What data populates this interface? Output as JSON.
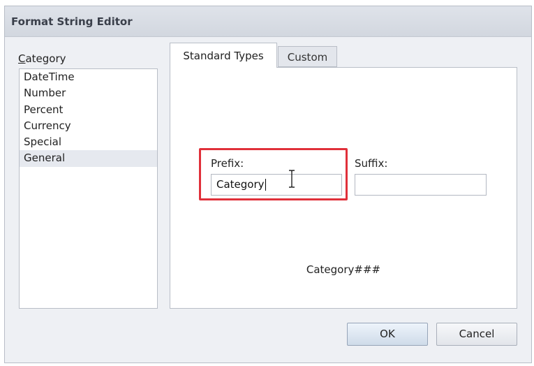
{
  "dialog": {
    "title": "Format String Editor"
  },
  "category": {
    "label_accel": "C",
    "label_rest": "ategory",
    "items": [
      "DateTime",
      "Number",
      "Percent",
      "Currency",
      "Special",
      "General"
    ],
    "selected": "General"
  },
  "tabs": [
    {
      "label": "Standard Types",
      "active": true
    },
    {
      "label": "Custom",
      "active": false
    }
  ],
  "prefix": {
    "label": "Prefix:",
    "value": "Category"
  },
  "suffix": {
    "label": "Suffix:",
    "value": ""
  },
  "preview": "Category###",
  "buttons": {
    "ok": "OK",
    "cancel": "Cancel"
  },
  "colors": {
    "highlight": "#e0303a"
  },
  "icons": {
    "cursor": "text-cursor-ibeam-icon"
  }
}
